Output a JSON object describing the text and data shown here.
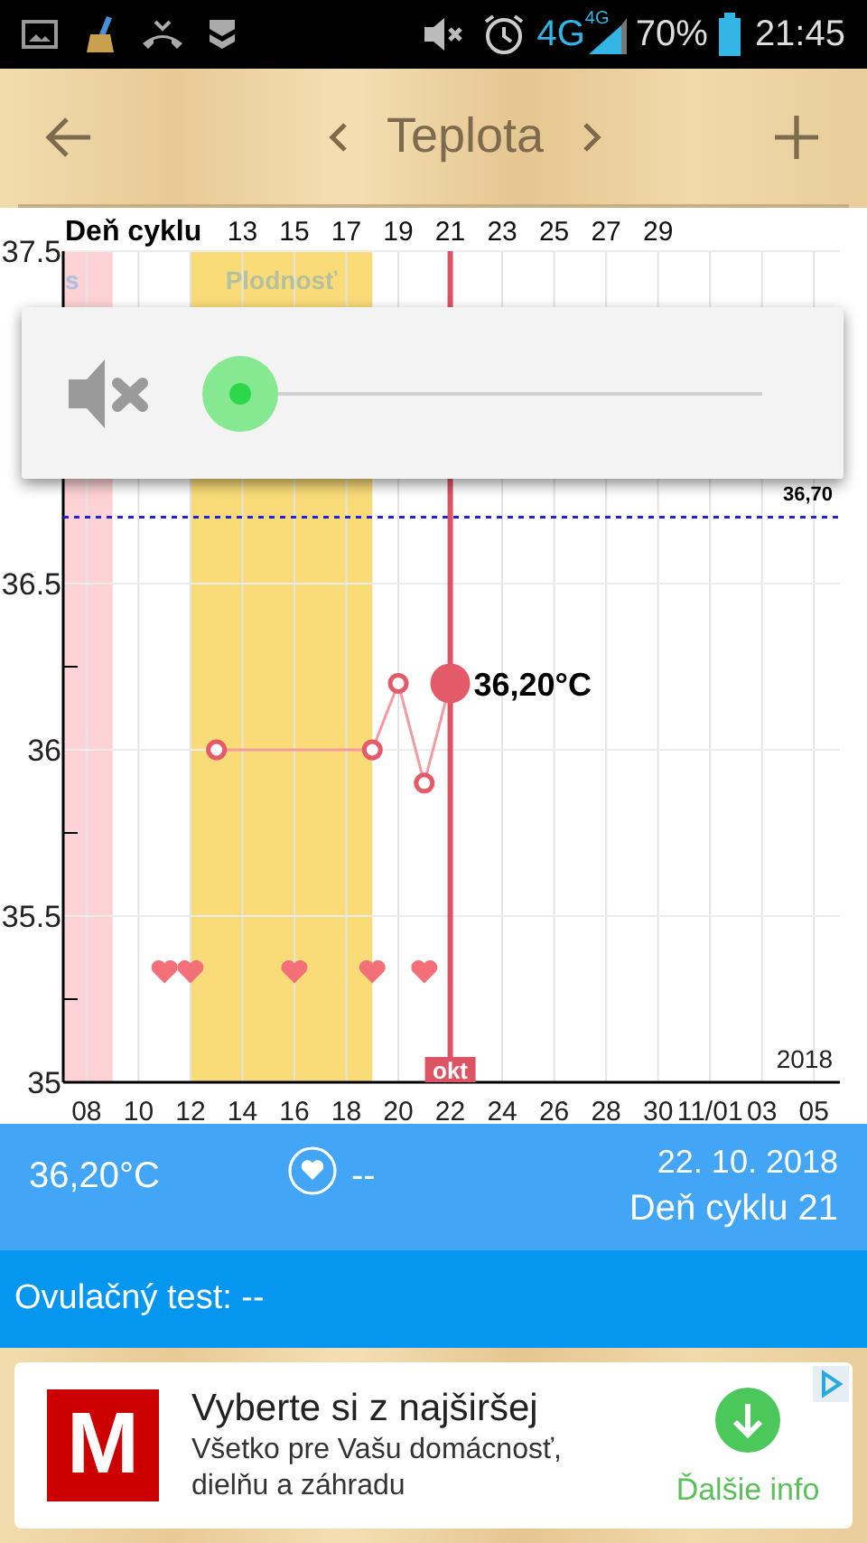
{
  "status_bar": {
    "network": "4G",
    "network_small": "4G",
    "battery": "70%",
    "time": "21:45"
  },
  "header": {
    "title": "Teplota"
  },
  "chart": {
    "next_month_ticks": [
      "11/01",
      "03",
      "05"
    ],
    "cycle_axis": {
      "title": "Deň cyklu",
      "ticks": [
        "13",
        "15",
        "17",
        "19",
        "21",
        "23",
        "25",
        "27",
        "29"
      ]
    },
    "chart_data": {
      "type": "line",
      "xlim": [
        7.1,
        37
      ],
      "ylim": [
        35,
        37.5
      ],
      "grid": true,
      "yticks": [
        35,
        35.5,
        36,
        36.5,
        37.5
      ],
      "xticks": [
        {
          "value": 8,
          "label": "08"
        },
        {
          "value": 10,
          "label": "10"
        },
        {
          "value": 12,
          "label": "12"
        },
        {
          "value": 14,
          "label": "14"
        },
        {
          "value": 16,
          "label": "16"
        },
        {
          "value": 18,
          "label": "18"
        },
        {
          "value": 20,
          "label": "20"
        },
        {
          "value": 22,
          "label": "22"
        },
        {
          "value": 24,
          "label": "24"
        },
        {
          "value": 26,
          "label": "26"
        },
        {
          "value": 28,
          "label": "28"
        },
        {
          "value": 30,
          "label": "30"
        }
      ],
      "x": [
        13,
        19,
        20,
        21,
        22
      ],
      "series": [
        {
          "color": "#e35a68",
          "marker": "circle",
          "values": [
            36.0,
            36.0,
            36.2,
            35.9,
            36.2
          ]
        },
        {
          "type": "scatter",
          "color": "#f47078",
          "x": [
            11,
            12,
            16,
            19,
            21
          ],
          "values": [
            35.33,
            35.33,
            35.33,
            35.33,
            35.33
          ]
        }
      ],
      "bands": [
        {
          "axis": "x",
          "from": 7.1,
          "to": 9,
          "label": "s",
          "color": "#fdd3d5"
        },
        {
          "axis": "x",
          "from": 12,
          "to": 19,
          "label": "Plodnosť",
          "color": "#f9dc78"
        }
      ],
      "ref_lines": [
        {
          "axis": "y",
          "value": 36.7,
          "label": "36,70",
          "color": "#2222dd"
        },
        {
          "axis": "x",
          "value": 22,
          "label": "okt",
          "color": "#dc5464"
        }
      ],
      "annotations": [
        {
          "text": "36,20°C",
          "x": 22,
          "y": 36.2
        },
        {
          "text": "2018"
        }
      ]
    }
  },
  "volume_popup": {
    "muted": true
  },
  "info": {
    "temperature": "36,20°C",
    "intercourse": "--",
    "date": "22. 10. 2018",
    "cycle_day": "Deň cyklu 21"
  },
  "ovulation": {
    "text": "Ovulačný test: --"
  },
  "ad": {
    "logo": "M",
    "title": "Vyberte si z najširšej",
    "description": "Všetko pre Vašu domácnosť, dielňu a záhradu",
    "action": "Ďalšie info"
  }
}
